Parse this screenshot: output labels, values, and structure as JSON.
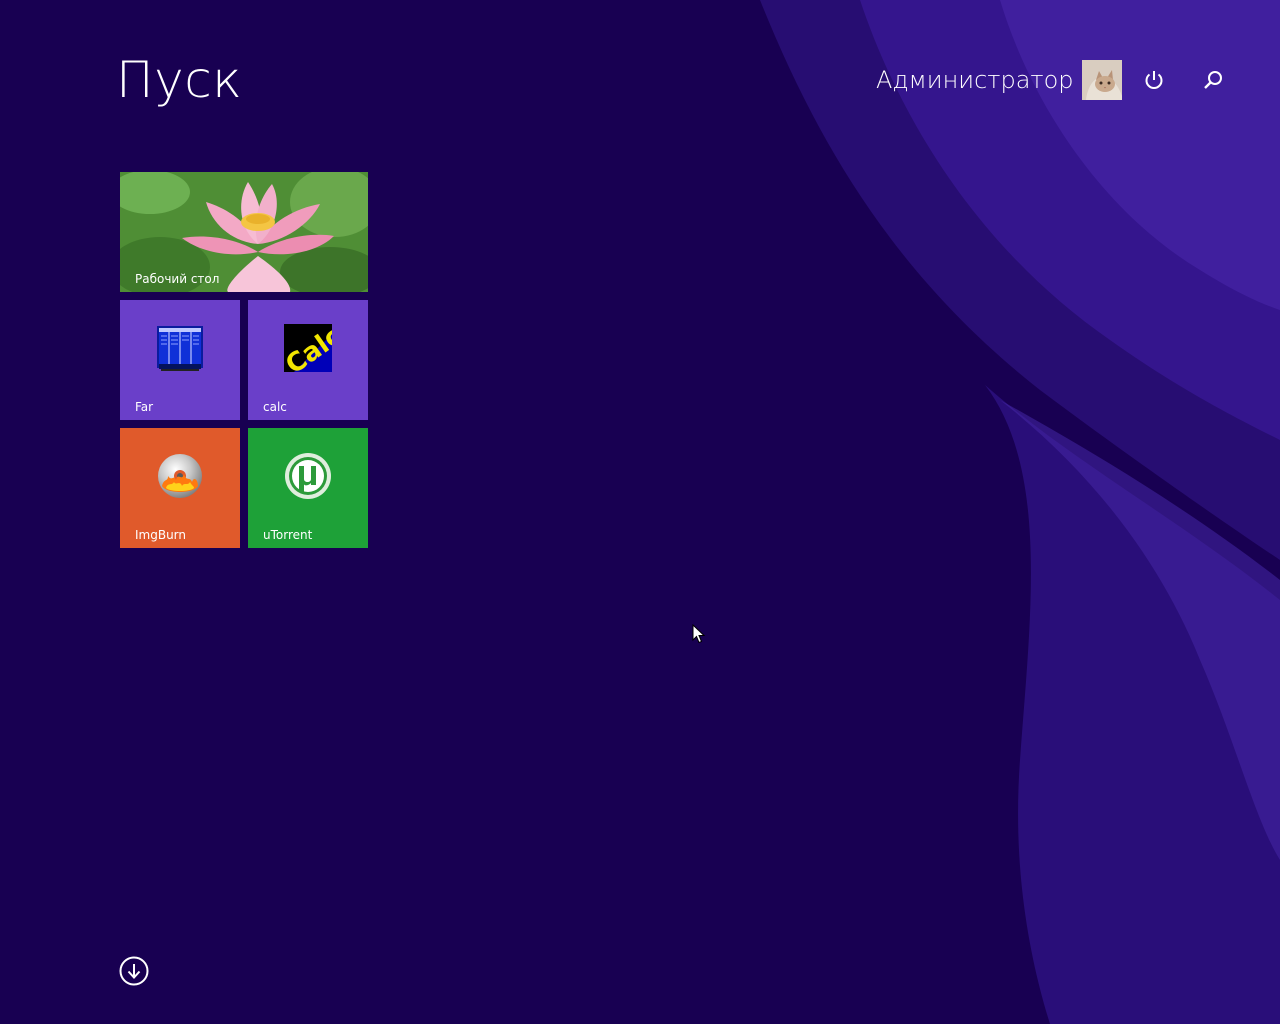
{
  "screen": {
    "title": "Пуск",
    "background_color": "#180052"
  },
  "user": {
    "name": "Администратор",
    "avatar_icon": "cat-avatar"
  },
  "top_buttons": {
    "power_icon": "power-icon",
    "search_icon": "search-icon"
  },
  "tiles": [
    {
      "label": "Рабочий стол",
      "color": "#5a9a3c",
      "icon": "lotus-wallpaper"
    },
    {
      "label": "Far",
      "color": "#6a3fc9",
      "icon": "far-manager-icon"
    },
    {
      "label": "calc",
      "color": "#6a3fc9",
      "icon": "calc-icon"
    },
    {
      "label": "ImgBurn",
      "color": "#e05a2b",
      "icon": "imgburn-disc-icon"
    },
    {
      "label": "uTorrent",
      "color": "#1ea138",
      "icon": "utorrent-icon"
    }
  ],
  "footer": {
    "all_apps_icon": "arrow-down-circle-icon"
  }
}
